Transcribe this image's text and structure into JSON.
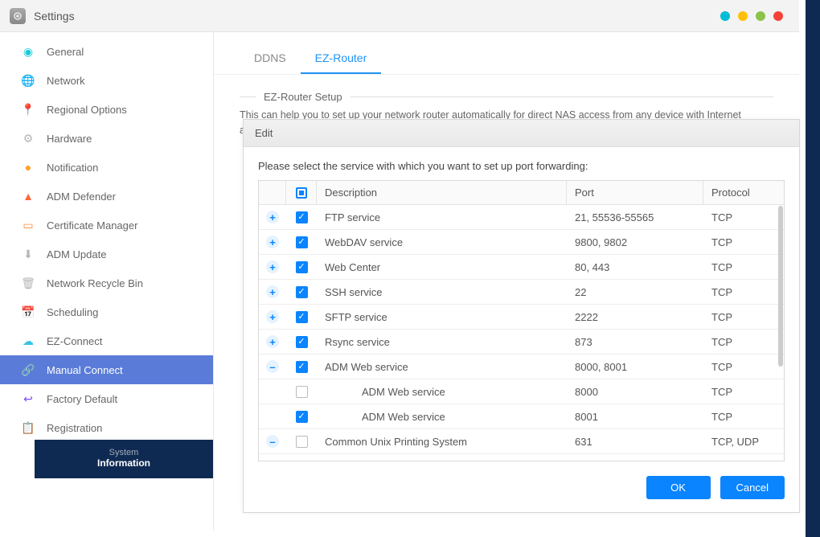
{
  "window": {
    "title": "Settings"
  },
  "sidebar": {
    "items": [
      {
        "label": "General"
      },
      {
        "label": "Network"
      },
      {
        "label": "Regional Options"
      },
      {
        "label": "Hardware"
      },
      {
        "label": "Notification"
      },
      {
        "label": "ADM Defender"
      },
      {
        "label": "Certificate Manager"
      },
      {
        "label": "ADM Update"
      },
      {
        "label": "Network Recycle Bin"
      },
      {
        "label": "Scheduling"
      },
      {
        "label": "EZ-Connect"
      },
      {
        "label": "Manual Connect"
      },
      {
        "label": "Factory Default"
      },
      {
        "label": "Registration"
      }
    ],
    "bottom_panel": {
      "line1": "System",
      "line2": "Information"
    }
  },
  "main": {
    "tabs": {
      "ddns": "DDNS",
      "ezrouter": "EZ-Router"
    },
    "section_title": "EZ-Router Setup",
    "section_desc": "This can help you to set up your network router automatically for direct NAS access from any device with Internet access. (e.g. laptop and mobile phone)"
  },
  "modal": {
    "title": "Edit",
    "message": "Please select the service with which you want to set up port forwarding:",
    "headers": {
      "description": "Description",
      "port": "Port",
      "protocol": "Protocol"
    },
    "rows": [
      {
        "expand": "plus",
        "checked": true,
        "desc": "FTP service",
        "port": "21, 55536-55565",
        "proto": "TCP"
      },
      {
        "expand": "plus",
        "checked": true,
        "desc": "WebDAV service",
        "port": "9800, 9802",
        "proto": "TCP"
      },
      {
        "expand": "plus",
        "checked": true,
        "desc": "Web Center",
        "port": "80, 443",
        "proto": "TCP"
      },
      {
        "expand": "plus",
        "checked": true,
        "desc": "SSH service",
        "port": "22",
        "proto": "TCP"
      },
      {
        "expand": "plus",
        "checked": true,
        "desc": "SFTP service",
        "port": "2222",
        "proto": "TCP"
      },
      {
        "expand": "plus",
        "checked": true,
        "desc": "Rsync service",
        "port": "873",
        "proto": "TCP"
      },
      {
        "expand": "minus",
        "checked": true,
        "desc": "ADM Web service",
        "port": "8000, 8001",
        "proto": "TCP"
      },
      {
        "expand": "",
        "checked": false,
        "desc": "ADM Web service",
        "port": "8000",
        "proto": "TCP",
        "child": true
      },
      {
        "expand": "",
        "checked": true,
        "desc": "ADM Web service",
        "port": "8001",
        "proto": "TCP",
        "child": true
      },
      {
        "expand": "minus",
        "checked": false,
        "desc": "Common Unix Printing System",
        "port": "631",
        "proto": "TCP, UDP"
      }
    ],
    "buttons": {
      "ok": "OK",
      "cancel": "Cancel"
    }
  }
}
